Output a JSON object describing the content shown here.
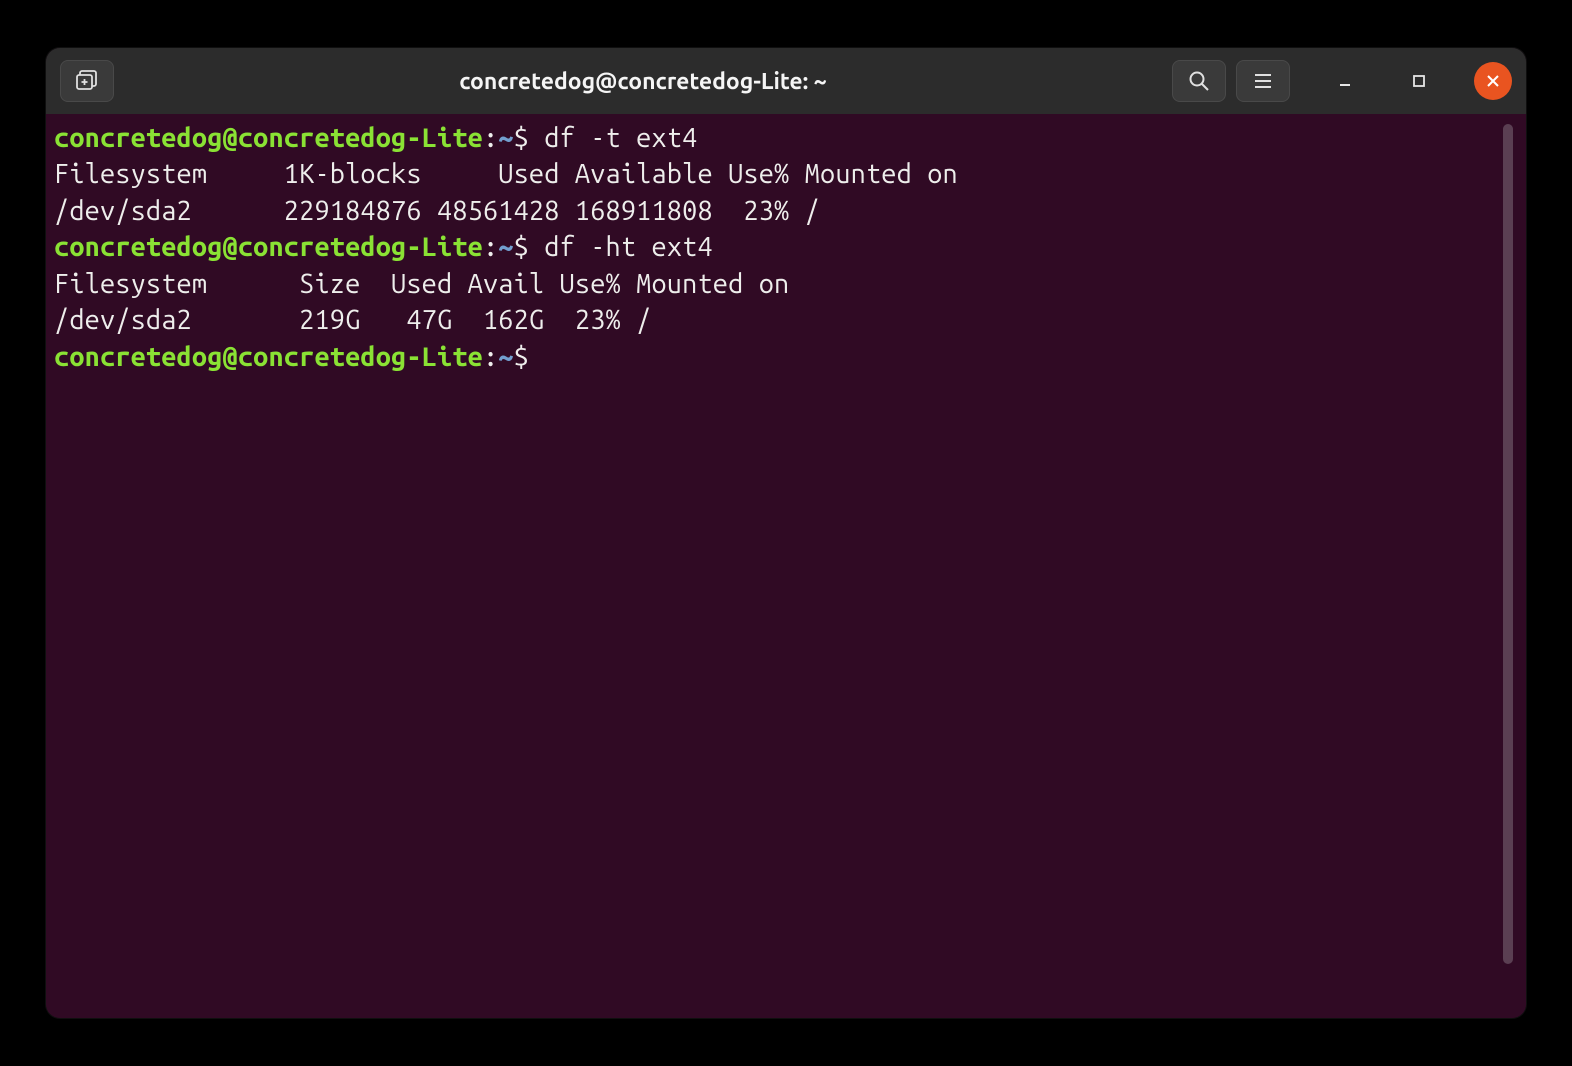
{
  "window": {
    "title": "concretedog@concretedog-Lite: ~"
  },
  "prompt": {
    "user_host": "concretedog@concretedog-Lite",
    "colon": ":",
    "cwd": "~",
    "symbol": "$"
  },
  "session": [
    {
      "command": "df -t ext4",
      "output_lines": [
        "Filesystem     1K-blocks     Used Available Use% Mounted on",
        "/dev/sda2      229184876 48561428 168911808  23% /"
      ]
    },
    {
      "command": "df -ht ext4",
      "output_lines": [
        "Filesystem      Size  Used Avail Use% Mounted on",
        "/dev/sda2       219G   47G  162G  23% /"
      ]
    },
    {
      "command": "",
      "output_lines": []
    }
  ]
}
